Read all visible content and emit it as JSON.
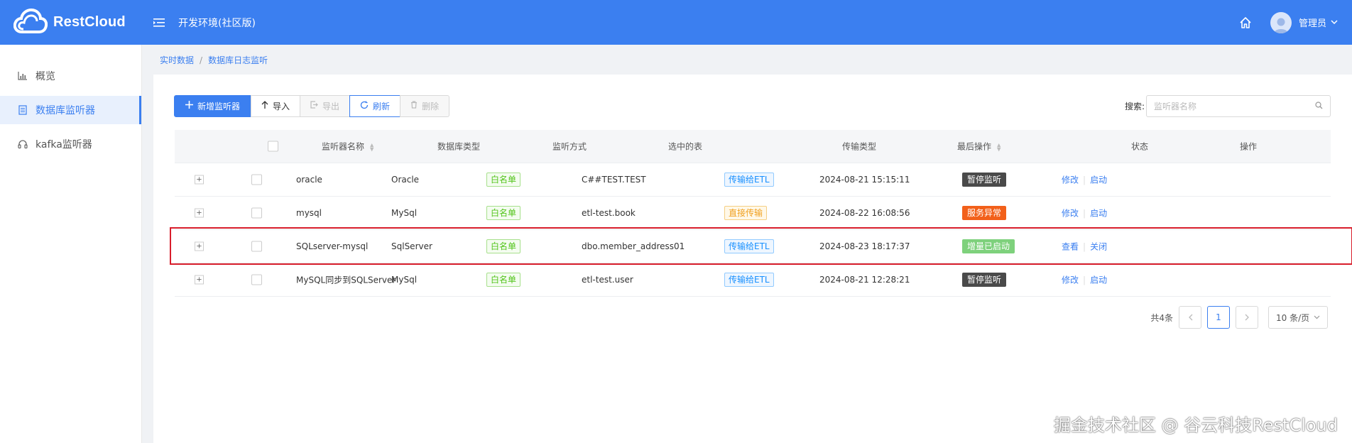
{
  "header": {
    "brand": "RestCloud",
    "env_title": "开发环境(社区版)",
    "user_name": "管理员"
  },
  "sidebar": {
    "items": [
      {
        "label": "概览",
        "icon": "bar-chart-icon",
        "active": false
      },
      {
        "label": "数据库监听器",
        "icon": "document-icon",
        "active": true
      },
      {
        "label": "kafka监听器",
        "icon": "headset-icon",
        "active": false
      }
    ]
  },
  "breadcrumb": {
    "root": "实时数据",
    "sep": "/",
    "current": "数据库日志监听"
  },
  "toolbar": {
    "add_label": "新增监听器",
    "import_label": "导入",
    "export_label": "导出",
    "refresh_label": "刷新",
    "delete_label": "删除"
  },
  "search": {
    "label": "搜索:",
    "placeholder": "监听器名称"
  },
  "table": {
    "columns": {
      "name": "监听器名称",
      "db_type": "数据库类型",
      "listen_mode": "监听方式",
      "tables": "选中的表",
      "transfer": "传输类型",
      "last_op": "最后操作",
      "status": "状态",
      "ops": "操作"
    },
    "rows": [
      {
        "expand": "+",
        "name": "oracle",
        "db_type": "Oracle",
        "listen_mode": "白名单",
        "tables": "C##TEST.TEST",
        "transfer": "传输给ETL",
        "transfer_style": "blue",
        "last_op": "2024-08-21 15:15:11",
        "status": "暂停监听",
        "status_style": "dark",
        "op1": "修改",
        "op2": "启动"
      },
      {
        "expand": "+",
        "name": "mysql",
        "db_type": "MySql",
        "listen_mode": "白名单",
        "tables": "etl-test.book",
        "transfer": "直接传输",
        "transfer_style": "orange",
        "last_op": "2024-08-22 16:08:56",
        "status": "服务异常",
        "status_style": "red",
        "op1": "修改",
        "op2": "启动"
      },
      {
        "expand": "+",
        "name": "SQLserver-mysql",
        "db_type": "SqlServer",
        "listen_mode": "白名单",
        "tables": "dbo.member_address01",
        "transfer": "传输给ETL",
        "transfer_style": "blue",
        "last_op": "2024-08-23 18:17:37",
        "status": "增量已启动",
        "status_style": "lightgreen",
        "op1": "查看",
        "op2": "关闭"
      },
      {
        "expand": "+",
        "name": "MySQL同步到SQLServer",
        "db_type": "MySql",
        "listen_mode": "白名单",
        "tables": "etl-test.user",
        "transfer": "传输给ETL",
        "transfer_style": "blue",
        "last_op": "2024-08-21 12:28:21",
        "status": "暂停监听",
        "status_style": "dark",
        "op1": "修改",
        "op2": "启动"
      }
    ]
  },
  "pagination": {
    "total": "共4条",
    "current_page": "1",
    "page_size": "10 条/页"
  },
  "watermark": "掘金技术社区 @ 谷云科技RestCloud",
  "colors": {
    "primary": "#3b7ff0",
    "highlight_border": "#d81e2c"
  }
}
